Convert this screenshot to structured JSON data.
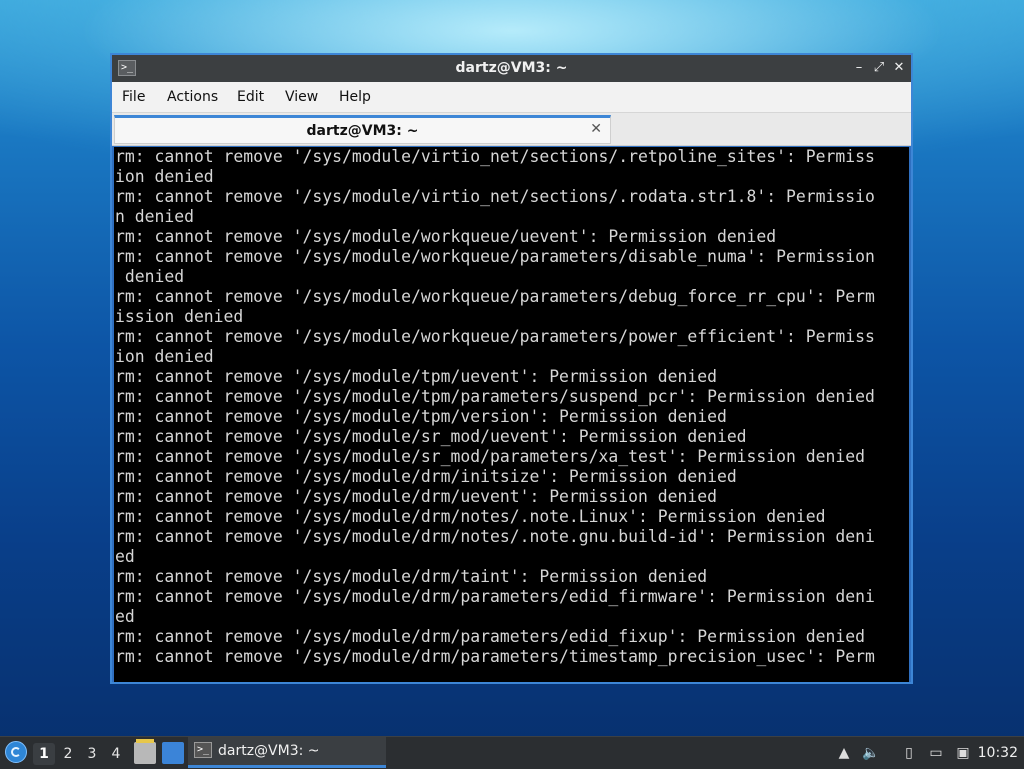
{
  "window": {
    "title": "dartz@VM3: ~",
    "minimize_glyph": "–",
    "maximize_glyph": "⤢",
    "close_glyph": "✕"
  },
  "menu": {
    "items": [
      "File",
      "Actions",
      "Edit",
      "View",
      "Help"
    ]
  },
  "tab": {
    "label": "dartz@VM3: ~",
    "close_glyph": "✕"
  },
  "terminal": {
    "lines": [
      "rm: cannot remove '/sys/module/virtio_net/sections/.retpoline_sites': Permiss",
      "ion denied",
      "rm: cannot remove '/sys/module/virtio_net/sections/.rodata.str1.8': Permissio",
      "n denied",
      "rm: cannot remove '/sys/module/workqueue/uevent': Permission denied",
      "rm: cannot remove '/sys/module/workqueue/parameters/disable_numa': Permission",
      " denied",
      "rm: cannot remove '/sys/module/workqueue/parameters/debug_force_rr_cpu': Perm",
      "ission denied",
      "rm: cannot remove '/sys/module/workqueue/parameters/power_efficient': Permiss",
      "ion denied",
      "rm: cannot remove '/sys/module/tpm/uevent': Permission denied",
      "rm: cannot remove '/sys/module/tpm/parameters/suspend_pcr': Permission denied",
      "rm: cannot remove '/sys/module/tpm/version': Permission denied",
      "rm: cannot remove '/sys/module/sr_mod/uevent': Permission denied",
      "rm: cannot remove '/sys/module/sr_mod/parameters/xa_test': Permission denied",
      "rm: cannot remove '/sys/module/drm/initsize': Permission denied",
      "rm: cannot remove '/sys/module/drm/uevent': Permission denied",
      "rm: cannot remove '/sys/module/drm/notes/.note.Linux': Permission denied",
      "rm: cannot remove '/sys/module/drm/notes/.note.gnu.build-id': Permission deni",
      "ed",
      "rm: cannot remove '/sys/module/drm/taint': Permission denied",
      "rm: cannot remove '/sys/module/drm/parameters/edid_firmware': Permission deni",
      "ed",
      "rm: cannot remove '/sys/module/drm/parameters/edid_fixup': Permission denied",
      "rm: cannot remove '/sys/module/drm/parameters/timestamp_precision_usec': Perm"
    ]
  },
  "taskbar": {
    "workspaces": [
      "1",
      "2",
      "3",
      "4"
    ],
    "active_workspace": "1",
    "task_label": "dartz@VM3: ~",
    "terminal_glyph": ">_",
    "clock": "10:32",
    "tray_icons": [
      "removable-drive-icon",
      "volume-icon",
      "clipboard-icon",
      "network-icon",
      "user-icon"
    ]
  },
  "colors": {
    "accent": "#3d86d6",
    "terminal_bg": "#000000",
    "terminal_fg": "#d6d6d6"
  }
}
